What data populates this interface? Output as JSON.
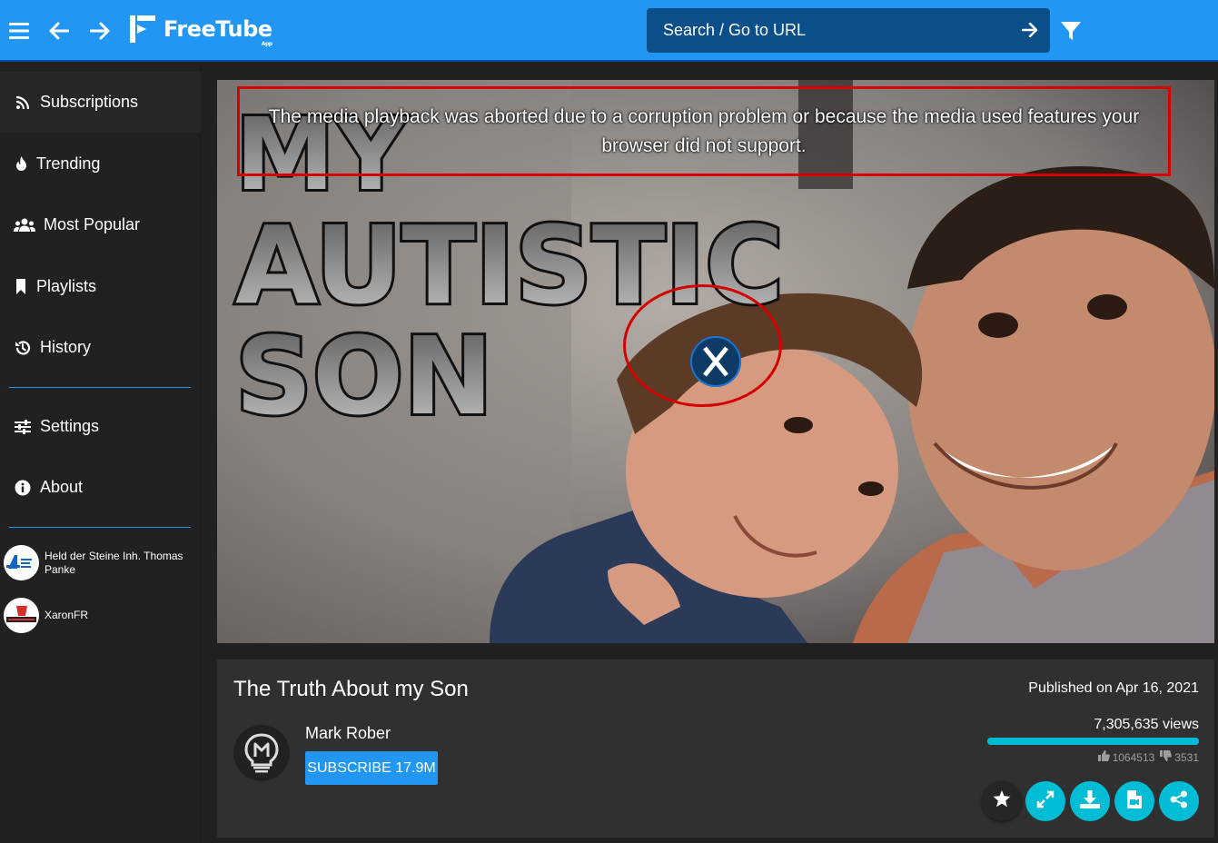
{
  "app": {
    "name": "FreeTube",
    "sub": "App"
  },
  "search": {
    "placeholder": "Search / Go to URL"
  },
  "sidebar": {
    "items": [
      {
        "label": "Subscriptions",
        "icon": "rss-icon"
      },
      {
        "label": "Trending",
        "icon": "fire-icon"
      },
      {
        "label": "Most Popular",
        "icon": "users-icon"
      },
      {
        "label": "Playlists",
        "icon": "bookmark-icon"
      },
      {
        "label": "History",
        "icon": "history-icon"
      },
      {
        "label": "Settings",
        "icon": "sliders-icon"
      },
      {
        "label": "About",
        "icon": "info-icon"
      }
    ],
    "subscriptions": [
      {
        "name": "Held der Steine Inh. Thomas Panke"
      },
      {
        "name": "XaronFR"
      }
    ]
  },
  "player": {
    "error_message": "The media playback was aborted due to a corruption problem or because the media used features your browser did not support.",
    "thumbnail_text": [
      "MY",
      "AUTISTIC",
      "SON"
    ]
  },
  "video": {
    "title": "The Truth About my Son",
    "channel": "Mark Rober",
    "subscribe_label": "SUBSCRIBE 17.9M",
    "published": "Published on Apr 16, 2021",
    "views": "7,305,635 views",
    "likes": "1064513",
    "dislikes": "3531",
    "like_ratio": 0.9967
  },
  "colors": {
    "accent": "#2196f3",
    "teal": "#00bcd4",
    "error": "#d50000"
  }
}
